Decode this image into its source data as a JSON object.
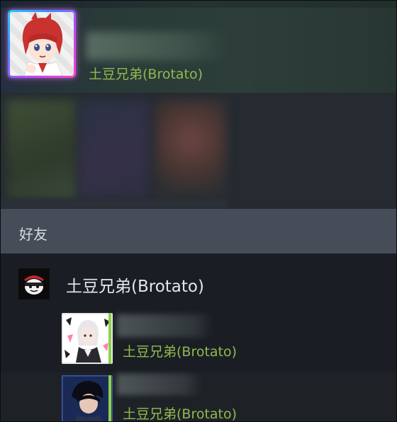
{
  "current_user": {
    "game": "土豆兄弟(Brotato)"
  },
  "friends_section": {
    "label": "好友"
  },
  "game_group": {
    "title": "土豆兄弟(Brotato)",
    "friends": [
      {
        "game": "土豆兄弟(Brotato)",
        "status_color": "#8fd14b"
      },
      {
        "game": "土豆兄弟(Brotato)",
        "status_color": "#8fd14b"
      }
    ]
  },
  "colors": {
    "in_game_green": "#8fba4f",
    "header_bg": "#464d59",
    "avatar_frame_gradient": [
      "#24c8ff",
      "#b54cff",
      "#ff3ec7"
    ]
  }
}
